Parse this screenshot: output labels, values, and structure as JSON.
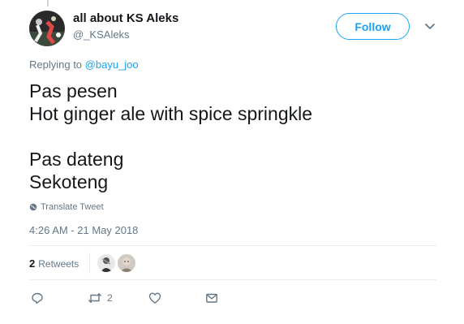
{
  "author": {
    "display_name": "all about KS Aleks",
    "handle": "@_KSAleks"
  },
  "follow_label": "Follow",
  "reply": {
    "prefix": "Replying to",
    "to": "@bayu_joo"
  },
  "tweet_text": "Pas pesen\nHot ginger ale with spice springkle\n\nPas dateng\nSekoteng",
  "translate_label": "Translate Tweet",
  "timestamp": "4:26 AM - 21 May 2018",
  "stats": {
    "retweet_count": "2",
    "retweet_label": "Retweets"
  },
  "actions": {
    "retweet_count": "2"
  },
  "colors": {
    "accent": "#1da1f2",
    "muted": "#657786",
    "text": "#14171a",
    "divider": "#e6ecf0"
  },
  "icons": [
    "reply-icon",
    "retweet-icon",
    "like-icon",
    "message-icon",
    "globe-icon",
    "chevron-down-icon"
  ]
}
